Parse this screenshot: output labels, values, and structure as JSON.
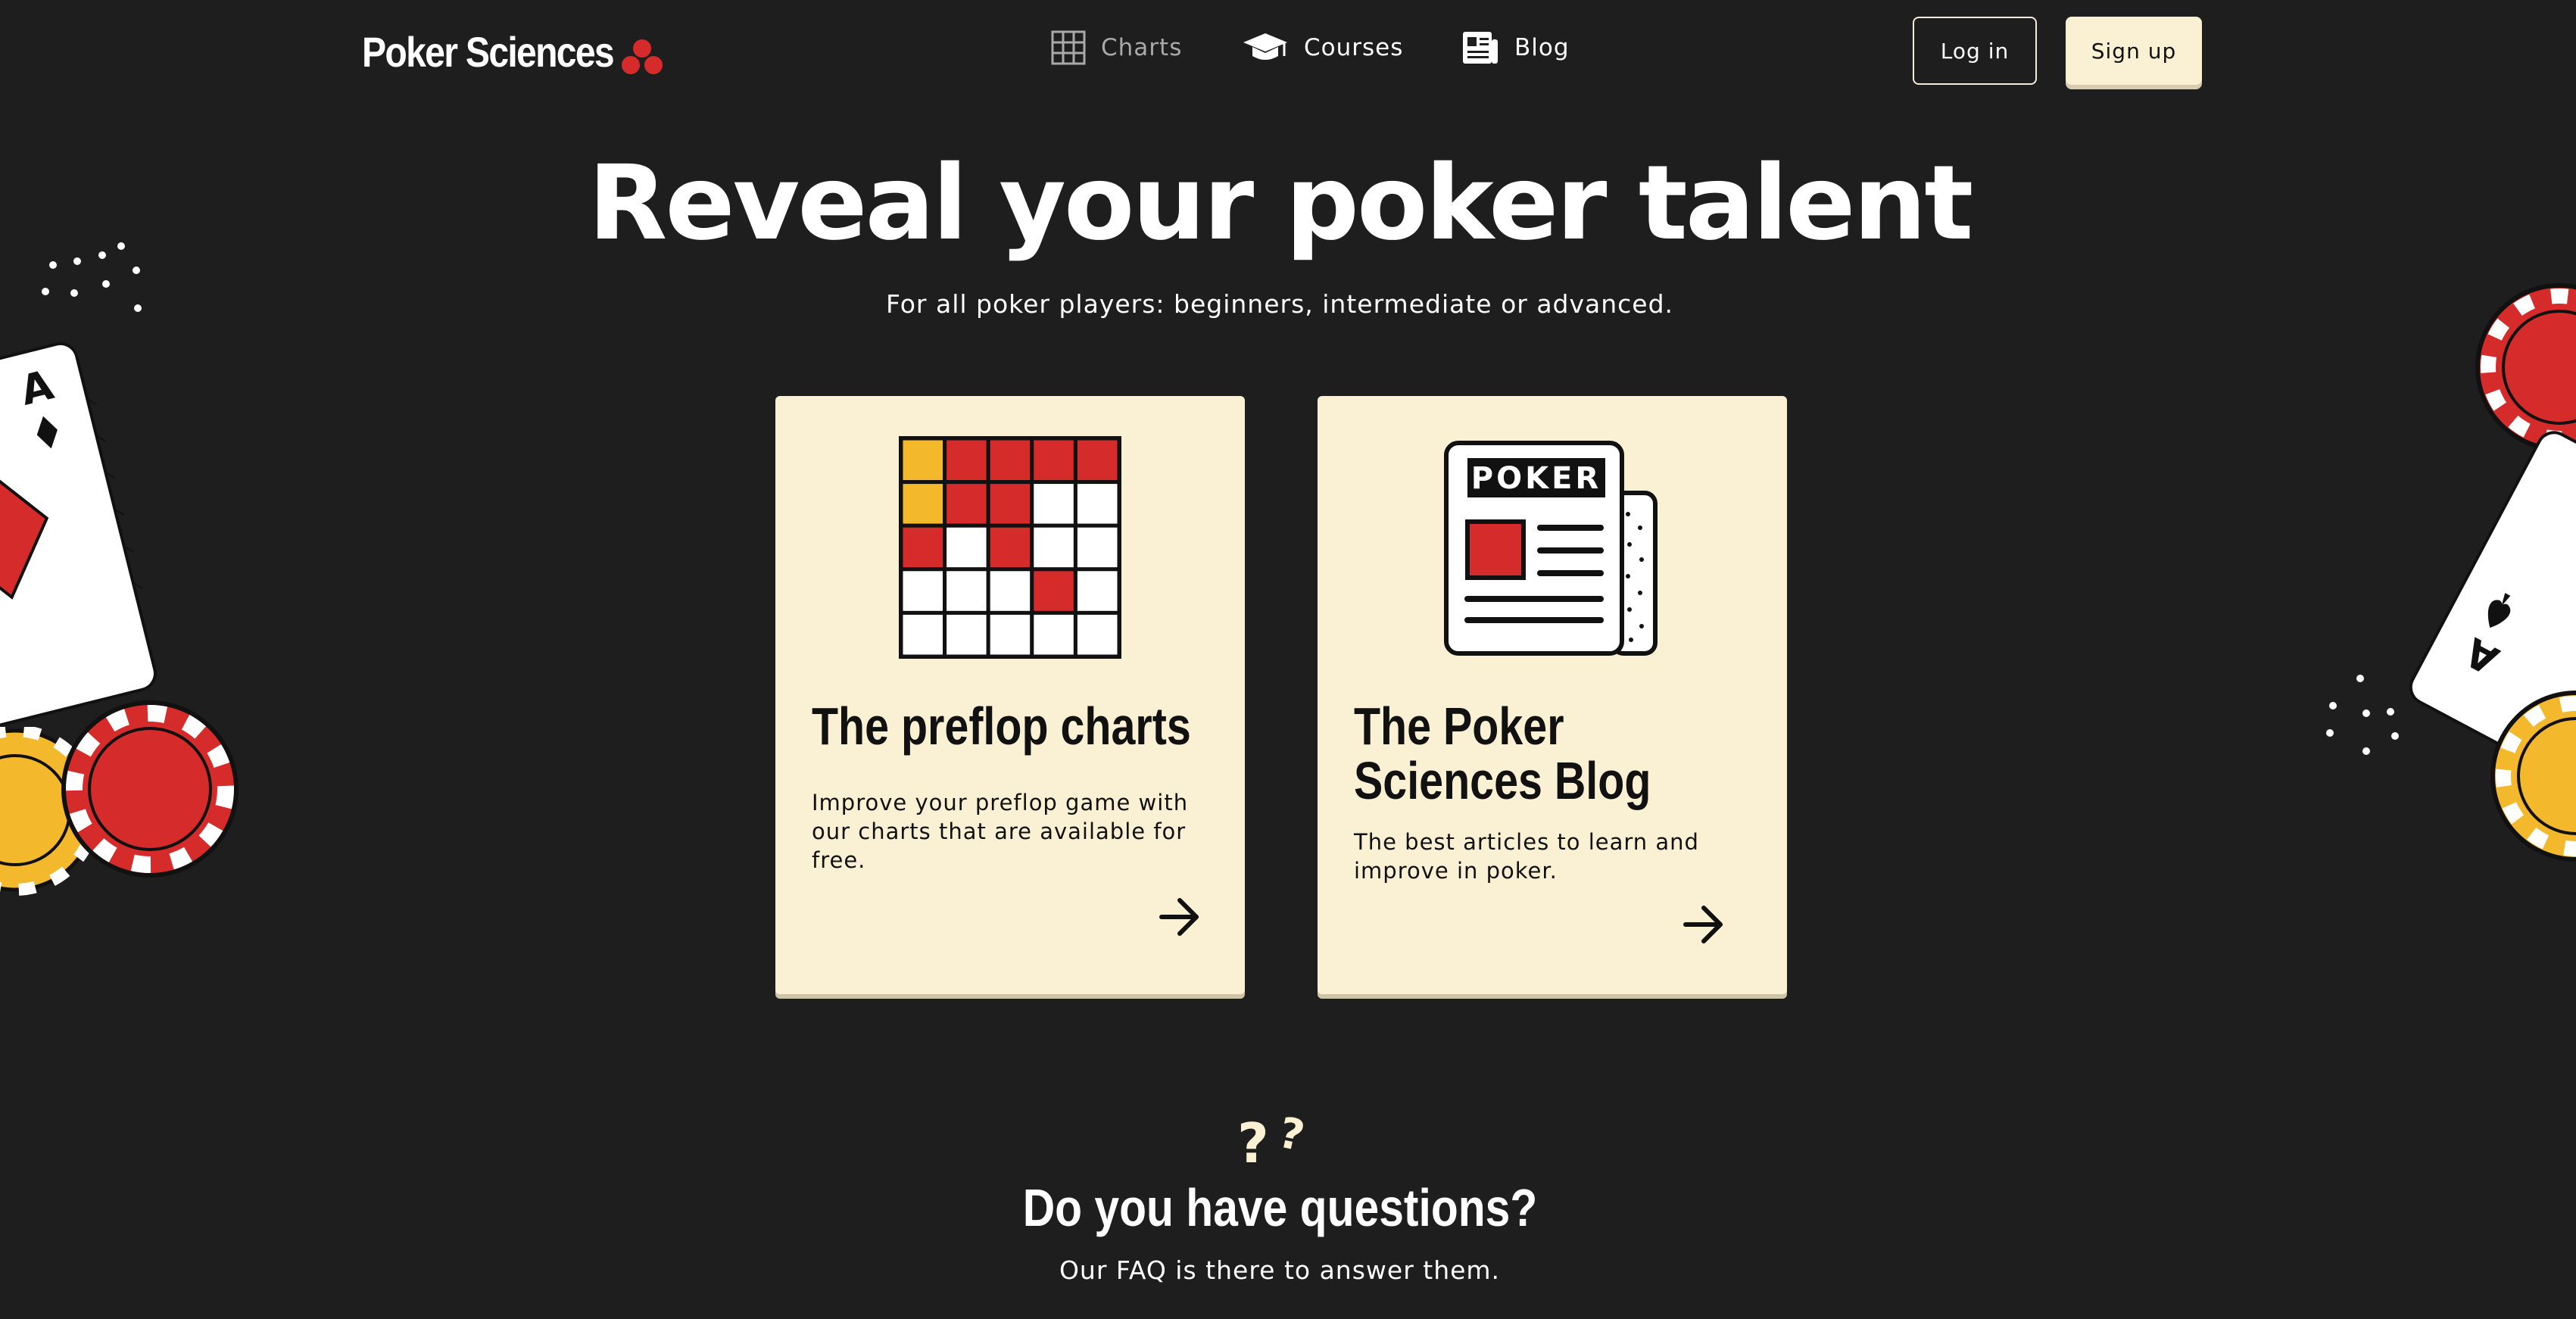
{
  "header": {
    "logo_text": "Poker Sciences",
    "nav": [
      {
        "label": "Charts",
        "icon": "grid-icon"
      },
      {
        "label": "Courses",
        "icon": "graduation-cap-icon"
      },
      {
        "label": "Blog",
        "icon": "newspaper-icon"
      }
    ],
    "login_label": "Log in",
    "signup_label": "Sign up"
  },
  "hero": {
    "title": "Reveal your poker talent",
    "subtitle": "For all poker players: beginners, intermediate or advanced."
  },
  "cards": [
    {
      "title": "The preflop charts",
      "description": "Improve your preflop game with our charts that are available for free.",
      "illustration": "preflop-grid-illustration"
    },
    {
      "title_line1": "The Poker",
      "title_line2": "Sciences Blog",
      "description": "The best articles to learn and improve in poker.",
      "newspaper_label": "POKER",
      "illustration": "newspaper-illustration"
    }
  ],
  "faq": {
    "title": "Do you have questions?",
    "subtitle": "Our FAQ is there to answer them."
  },
  "colors": {
    "background": "#1f1e1e",
    "card": "#faf0d3",
    "accent_red": "#d62b2b",
    "accent_yellow": "#f4b82c",
    "text_dark": "#111111"
  }
}
